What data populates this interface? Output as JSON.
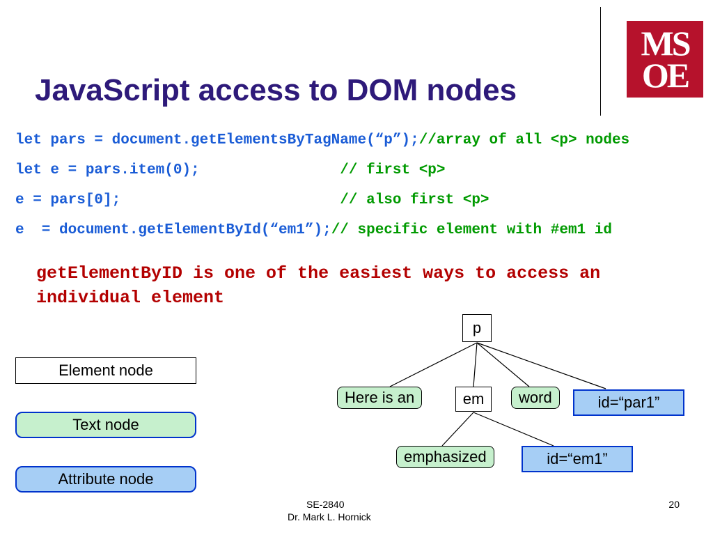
{
  "logo": {
    "line1": "MS",
    "line2": "OE"
  },
  "title": "JavaScript access to DOM nodes",
  "code": {
    "l1a": "let pars = document.getElementsByTagName(“p”);",
    "l1b": "//array of all <p> nodes",
    "l2a": "let e = pars.item(0);",
    "l2b": "                // first <p>",
    "l3a": "e = pars[0];",
    "l3b": "                         // also first <p>",
    "l4a": "e  = document.getElementById(“em1”);",
    "l4b": "// specific element with #em1 id"
  },
  "note": "getElementByID is one of the easiest ways to access an individual element",
  "legend": {
    "element": "Element node",
    "text": "Text node",
    "attribute": "Attribute node"
  },
  "tree": {
    "p": "p",
    "here": "Here is an",
    "em": "em",
    "word": "word",
    "idpar1": "id=“par1”",
    "emphasized": "emphasized",
    "idem1": "id=“em1”"
  },
  "footer": {
    "course": "SE-2840",
    "author": "Dr. Mark L. Hornick",
    "slide": "20"
  }
}
